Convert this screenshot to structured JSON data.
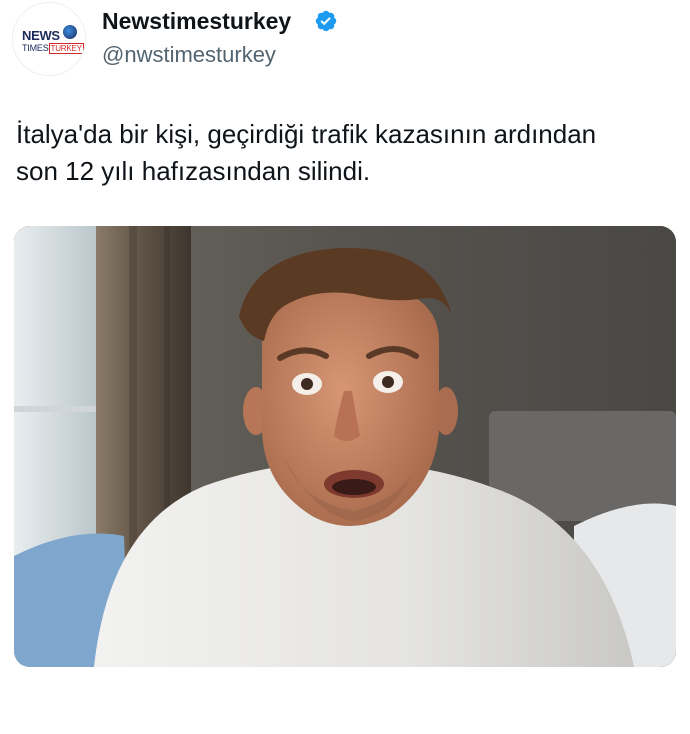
{
  "author": {
    "display_name": "Newstimesturkey",
    "handle": "@nwstimesturkey",
    "verified": true,
    "avatar_logo": {
      "line1": "NEWS",
      "line2_a": "TIMES",
      "line2_b": "TURKEY"
    }
  },
  "tweet": {
    "text_line1": "İtalya'da bir kişi, geçirdiği trafik kazasının ardından",
    "text_line2": "son 12 yılı hafızasından silindi."
  },
  "media": {
    "type": "photo",
    "subject": "shocked man in white t-shirt in bedroom"
  },
  "colors": {
    "text": "#0f1419",
    "secondary": "#536471",
    "verified": "#1d9bf0"
  },
  "icons": {
    "verified": "verified-badge-icon"
  }
}
